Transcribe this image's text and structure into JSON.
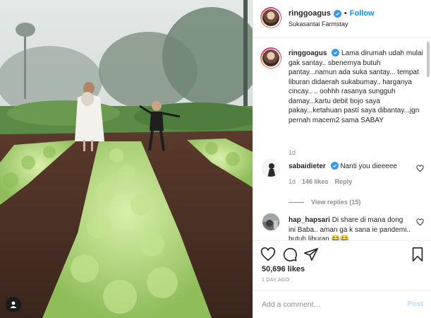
{
  "post": {
    "author": "ringgoagus",
    "follow_label": "Follow",
    "separator": "•",
    "location": "Sukasantai Farmstay"
  },
  "caption": {
    "username": "ringgoagus",
    "text": "Lama dirumah udah mulai gak santay.. sbenernya butuh pantay...namun ada suka santay... tempat liburan didaerah sukabumay.. harganya cincay.. .. oohhh rasanya sungguh damay...kartu debit bojo saya pakay...ketahuan pastí saya dibantay...jgn pernah macem2 sama SABAY",
    "time": "1d"
  },
  "comments": [
    {
      "username": "sabaidieter",
      "text": "Nanti you dieeeee",
      "time": "1d",
      "likes": "146 likes",
      "reply_label": "Reply",
      "view_replies": "View replies (15)"
    },
    {
      "username": "hap_hapsari",
      "text": "Di share di mana dong ini Baba.. aman ga k sana ie pandemi.. butuh liburan 😂😂"
    }
  ],
  "actions": {
    "likes": "50,696 likes",
    "date": "1 DAY AGO"
  },
  "add_comment": {
    "placeholder": "Add a comment…",
    "post_label": "Post"
  },
  "colors": {
    "accent": "#0095f6",
    "verified": "#3897f0",
    "muted": "#8e8e8e",
    "post_disabled": "#b2dffc"
  }
}
